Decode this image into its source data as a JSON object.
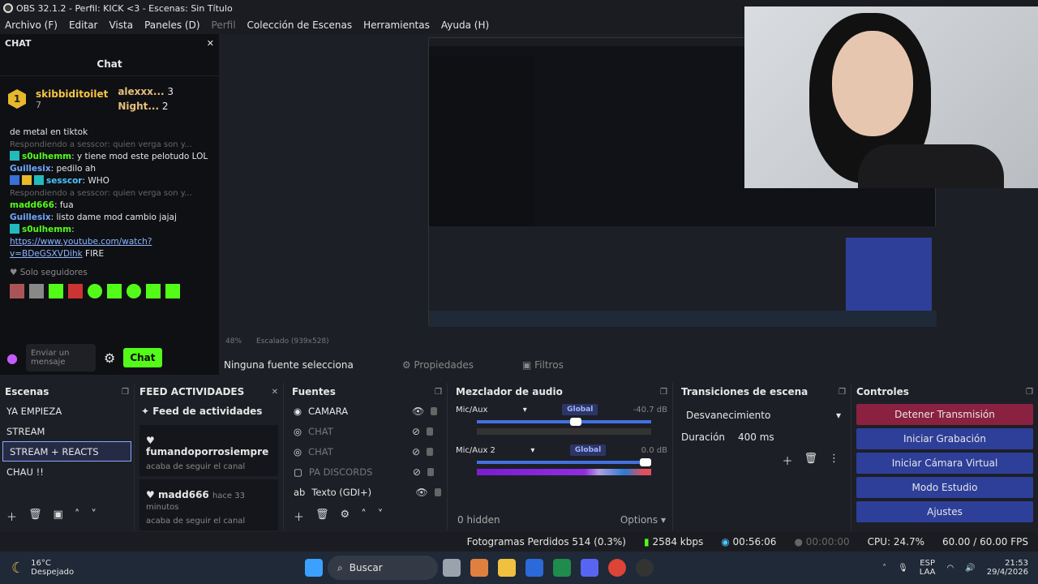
{
  "window": {
    "title": "OBS 32.1.2 - Perfil: KICK <3 - Escenas: Sin Título"
  },
  "menu": [
    "Archivo (F)",
    "Editar",
    "Vista",
    "Paneles (D)",
    "Perfil",
    "Colección de Escenas",
    "Herramientas",
    "Ayuda (H)"
  ],
  "chat": {
    "dock_title": "CHAT",
    "header": "Chat",
    "leaders": [
      {
        "rank": "1",
        "name": "skibbiditoilet",
        "count": "7"
      },
      {
        "name": "alexxx...",
        "count": "3"
      },
      {
        "name": "Night...",
        "count": "2"
      }
    ],
    "messages": [
      {
        "text": "de metal en tiktok"
      },
      {
        "reply": "Respondiendo a sesscor: quien verga son y..."
      },
      {
        "user": "s0ulhemm",
        "text": ": y tiene mod este pelotudo LOL"
      },
      {
        "user": "Guillesix",
        "text": ": pedilo ah"
      },
      {
        "user": "sesscor",
        "text": ": WHO"
      },
      {
        "reply": "Respondiendo a sesscor: quien verga son y..."
      },
      {
        "user": "madd666",
        "text": ": fua"
      },
      {
        "user": "Guillesix",
        "text": ": listo dame mod cambio jajaj"
      },
      {
        "user": "s0ulhemm",
        "link": "https://www.youtube.com/watch?v=BDeGSXVDihk",
        "text": " FIRE"
      }
    ],
    "followers_only": "Solo seguidores",
    "send_placeholder": "Enviar un mensaje",
    "chat_button": "Chat"
  },
  "preview": {
    "zoom": "48%",
    "scale": "Escalado (939x528)",
    "no_source": "Ninguna fuente selecciona",
    "properties": "Propiedades",
    "filters": "Filtros"
  },
  "scenes": {
    "title": "Escenas",
    "items": [
      "YA EMPIEZA",
      "STREAM",
      "STREAM + REACTS",
      "CHAU !!"
    ],
    "selected": "STREAM + REACTS"
  },
  "feed": {
    "title": "FEED ACTIVIDADES",
    "header": "Feed de actividades",
    "events": [
      {
        "name": "fumandoporrosiempre",
        "sub": "acaba de seguir el canal"
      },
      {
        "name": "madd666",
        "time": "hace 33 minutos",
        "sub": "acaba de seguir el canal"
      }
    ]
  },
  "sources": {
    "title": "Fuentes",
    "items": [
      {
        "name": "CAMARA",
        "visible": true
      },
      {
        "name": "CHAT",
        "visible": false
      },
      {
        "name": "CHAT",
        "visible": false
      },
      {
        "name": "PA DISCORDS",
        "visible": false
      },
      {
        "name": "Texto (GDI+)",
        "visible": true
      }
    ]
  },
  "mixer": {
    "title": "Mezclador de audio",
    "channels": [
      {
        "name": "Mic/Aux",
        "db": "-40.7 dB",
        "global": "Global",
        "level": 0.6
      },
      {
        "name": "Mic/Aux 2",
        "db": "0.0 dB",
        "global": "Global",
        "level": 1.0
      }
    ],
    "hidden": "0 hidden",
    "options": "Options",
    "ticks": [
      "-60",
      "-54",
      "-48",
      "-42",
      "-36",
      "-30",
      "-24",
      "-18",
      "-12",
      "-6",
      "0"
    ]
  },
  "transitions": {
    "title": "Transiciones de escena",
    "selected": "Desvanecimiento",
    "duration_label": "Duración",
    "duration": "400 ms"
  },
  "controls": {
    "title": "Controles",
    "buttons": [
      "Detener Transmisión",
      "Iniciar Grabación",
      "Iniciar Cámara Virtual",
      "Modo Estudio",
      "Ajustes"
    ]
  },
  "status": {
    "dropped": "Fotogramas Perdidos 514 (0.3%)",
    "bitrate": "2584 kbps",
    "stream_time": "00:56:06",
    "rec_time": "00:00:00",
    "cpu": "CPU: 24.7%",
    "fps": "60.00 / 60.00 FPS"
  },
  "taskbar": {
    "temp": "16°C",
    "weather": "Despejado",
    "search": "Buscar",
    "lang1": "ESP",
    "lang2": "LAA",
    "time": "21:53",
    "date": "29/4/2026"
  },
  "colors": {
    "kick_green": "#53fc18",
    "stop": "#8a2140",
    "control": "#2e3f99"
  }
}
